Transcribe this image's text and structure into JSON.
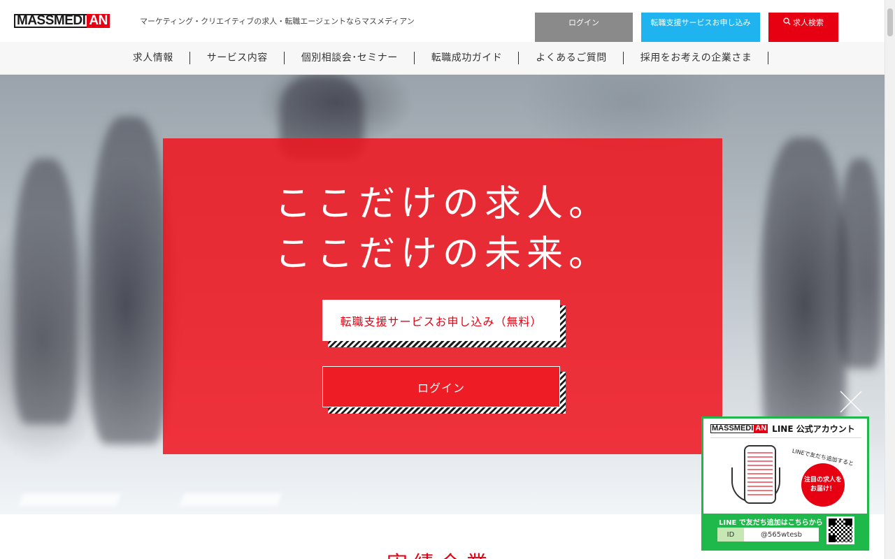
{
  "header": {
    "logo_black": "MASSMEDI",
    "logo_red": "AN",
    "tagline": "マーケティング・クリエイティブの求人・転職エージェントならマスメディアン",
    "login_label": "ログイン",
    "apply_label": "転職支援サービスお申し込み",
    "search_label": "求人検索",
    "search_icon": "search-icon"
  },
  "colors": {
    "brand_red": "#e60012",
    "apply_blue": "#1fb3f0",
    "login_gray": "#8a8a8a",
    "line_green": "#1fb84b"
  },
  "nav": {
    "items": [
      {
        "label": "求人情報"
      },
      {
        "label": "サービス内容"
      },
      {
        "label": "個別相談会･セミナー"
      },
      {
        "label": "転職成功ガイド"
      },
      {
        "label": "よくあるご質問"
      },
      {
        "label": "採用をお考えの企業さま"
      }
    ]
  },
  "hero": {
    "catch_line1": "ここだけの求人。",
    "catch_line2": "ここだけの未来。",
    "apply_button": "転職支援サービスお申し込み（無料）",
    "login_button": "ログイン"
  },
  "main": {
    "section_title": "実績企業"
  },
  "line_popup": {
    "logo_black": "MASSMEDI",
    "logo_red": "AN",
    "title": "LINE 公式アカウント",
    "small_text": "LINEで友だち追加すると",
    "bubble_line1": "注目の求人を",
    "bubble_line2": "お届け！",
    "cta": "LINE で友だち追加はこちらから",
    "id_label": "ID",
    "id_value": "@565wtesb",
    "close_icon": "close-icon"
  }
}
